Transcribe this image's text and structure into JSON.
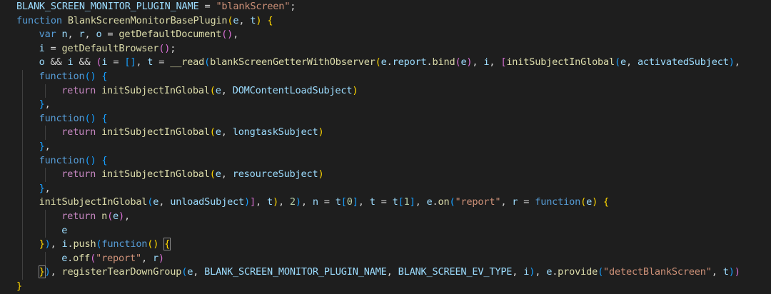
{
  "colors": {
    "background": "#1e1e1e",
    "var": "#9cdcfe",
    "keyword": "#569cd6",
    "control": "#c586c0",
    "function": "#dcdcaa",
    "string": "#ce9178",
    "number": "#b5cea8",
    "punct": "#d4d4d4",
    "bracket_gold": "#ffd700",
    "bracket_violet": "#da70d6",
    "bracket_blue": "#179fff",
    "indent_guide": "#404040"
  },
  "lines": [
    {
      "indent": 0,
      "guides": 0,
      "tokens": [
        [
          "BLANK_SCREEN_MONITOR_PLUGIN_NAME",
          "var"
        ],
        [
          " = ",
          "punct"
        ],
        [
          "\"blankScreen\"",
          "string"
        ],
        [
          ";",
          "punct"
        ]
      ]
    },
    {
      "indent": 0,
      "guides": 0,
      "tokens": [
        [
          "function",
          "keyword"
        ],
        [
          " ",
          "punct"
        ],
        [
          "BlankScreenMonitorBasePlugin",
          "function"
        ],
        [
          "(",
          "bracket_gold"
        ],
        [
          "e",
          "var"
        ],
        [
          ", ",
          "punct"
        ],
        [
          "t",
          "var"
        ],
        [
          ")",
          "bracket_gold"
        ],
        [
          " ",
          "punct"
        ],
        [
          "{",
          "bracket_gold"
        ]
      ]
    },
    {
      "indent": 1,
      "guides": 0,
      "tokens": [
        [
          "var",
          "keyword"
        ],
        [
          " ",
          "punct"
        ],
        [
          "n",
          "var"
        ],
        [
          ", ",
          "punct"
        ],
        [
          "r",
          "var"
        ],
        [
          ", ",
          "punct"
        ],
        [
          "o",
          "var"
        ],
        [
          " = ",
          "punct"
        ],
        [
          "getDefaultDocument",
          "function"
        ],
        [
          "()",
          "bracket_violet"
        ],
        [
          ",",
          "punct"
        ]
      ]
    },
    {
      "indent": 1,
      "guides": 0,
      "tokens": [
        [
          "i",
          "var"
        ],
        [
          " = ",
          "punct"
        ],
        [
          "getDefaultBrowser",
          "function"
        ],
        [
          "()",
          "bracket_violet"
        ],
        [
          ";",
          "punct"
        ]
      ]
    },
    {
      "indent": 1,
      "guides": 0,
      "tokens": [
        [
          "o",
          "var"
        ],
        [
          " && ",
          "punct"
        ],
        [
          "i",
          "var"
        ],
        [
          " && ",
          "punct"
        ],
        [
          "(",
          "bracket_violet"
        ],
        [
          "i",
          "var"
        ],
        [
          " = ",
          "punct"
        ],
        [
          "[]",
          "bracket_blue"
        ],
        [
          ", ",
          "punct"
        ],
        [
          "t",
          "var"
        ],
        [
          " = ",
          "punct"
        ],
        [
          "__read",
          "function"
        ],
        [
          "(",
          "bracket_blue"
        ],
        [
          "blankScreenGetterWithObserver",
          "function"
        ],
        [
          "(",
          "bracket_gold"
        ],
        [
          "e",
          "var"
        ],
        [
          ".",
          "punct"
        ],
        [
          "report",
          "var"
        ],
        [
          ".",
          "punct"
        ],
        [
          "bind",
          "function"
        ],
        [
          "(",
          "bracket_violet"
        ],
        [
          "e",
          "var"
        ],
        [
          ")",
          "bracket_violet"
        ],
        [
          ", ",
          "punct"
        ],
        [
          "i",
          "var"
        ],
        [
          ", ",
          "punct"
        ],
        [
          "[",
          "bracket_violet"
        ],
        [
          "initSubjectInGlobal",
          "function"
        ],
        [
          "(",
          "bracket_blue"
        ],
        [
          "e",
          "var"
        ],
        [
          ", ",
          "punct"
        ],
        [
          "activatedSubject",
          "var"
        ],
        [
          ")",
          "bracket_blue"
        ],
        [
          ",",
          "punct"
        ]
      ]
    },
    {
      "indent": 1,
      "guides": 1,
      "tokens": [
        [
          "function",
          "keyword"
        ],
        [
          "()",
          "bracket_blue"
        ],
        [
          " ",
          "punct"
        ],
        [
          "{",
          "bracket_blue"
        ]
      ]
    },
    {
      "indent": 2,
      "guides": 2,
      "tokens": [
        [
          "return",
          "control"
        ],
        [
          " ",
          "punct"
        ],
        [
          "initSubjectInGlobal",
          "function"
        ],
        [
          "(",
          "bracket_gold"
        ],
        [
          "e",
          "var"
        ],
        [
          ", ",
          "punct"
        ],
        [
          "DOMContentLoadSubject",
          "var"
        ],
        [
          ")",
          "bracket_gold"
        ]
      ]
    },
    {
      "indent": 1,
      "guides": 1,
      "tokens": [
        [
          "}",
          "bracket_blue"
        ],
        [
          ",",
          "punct"
        ]
      ]
    },
    {
      "indent": 1,
      "guides": 1,
      "tokens": [
        [
          "function",
          "keyword"
        ],
        [
          "()",
          "bracket_blue"
        ],
        [
          " ",
          "punct"
        ],
        [
          "{",
          "bracket_blue"
        ]
      ]
    },
    {
      "indent": 2,
      "guides": 2,
      "tokens": [
        [
          "return",
          "control"
        ],
        [
          " ",
          "punct"
        ],
        [
          "initSubjectInGlobal",
          "function"
        ],
        [
          "(",
          "bracket_gold"
        ],
        [
          "e",
          "var"
        ],
        [
          ", ",
          "punct"
        ],
        [
          "longtaskSubject",
          "var"
        ],
        [
          ")",
          "bracket_gold"
        ]
      ]
    },
    {
      "indent": 1,
      "guides": 1,
      "tokens": [
        [
          "}",
          "bracket_blue"
        ],
        [
          ",",
          "punct"
        ]
      ]
    },
    {
      "indent": 1,
      "guides": 1,
      "tokens": [
        [
          "function",
          "keyword"
        ],
        [
          "()",
          "bracket_blue"
        ],
        [
          " ",
          "punct"
        ],
        [
          "{",
          "bracket_blue"
        ]
      ]
    },
    {
      "indent": 2,
      "guides": 2,
      "tokens": [
        [
          "return",
          "control"
        ],
        [
          " ",
          "punct"
        ],
        [
          "initSubjectInGlobal",
          "function"
        ],
        [
          "(",
          "bracket_gold"
        ],
        [
          "e",
          "var"
        ],
        [
          ", ",
          "punct"
        ],
        [
          "resourceSubject",
          "var"
        ],
        [
          ")",
          "bracket_gold"
        ]
      ]
    },
    {
      "indent": 1,
      "guides": 1,
      "tokens": [
        [
          "}",
          "bracket_blue"
        ],
        [
          ",",
          "punct"
        ]
      ]
    },
    {
      "indent": 1,
      "guides": 1,
      "tokens": [
        [
          "initSubjectInGlobal",
          "function"
        ],
        [
          "(",
          "bracket_blue"
        ],
        [
          "e",
          "var"
        ],
        [
          ", ",
          "punct"
        ],
        [
          "unloadSubject",
          "var"
        ],
        [
          ")",
          "bracket_blue"
        ],
        [
          "]",
          "bracket_violet"
        ],
        [
          ", ",
          "punct"
        ],
        [
          "t",
          "var"
        ],
        [
          ")",
          "bracket_gold"
        ],
        [
          ", ",
          "punct"
        ],
        [
          "2",
          "number"
        ],
        [
          ")",
          "bracket_blue"
        ],
        [
          ", ",
          "punct"
        ],
        [
          "n",
          "var"
        ],
        [
          " = ",
          "punct"
        ],
        [
          "t",
          "var"
        ],
        [
          "[",
          "bracket_blue"
        ],
        [
          "0",
          "number"
        ],
        [
          "]",
          "bracket_blue"
        ],
        [
          ", ",
          "punct"
        ],
        [
          "t",
          "var"
        ],
        [
          " = ",
          "punct"
        ],
        [
          "t",
          "var"
        ],
        [
          "[",
          "bracket_blue"
        ],
        [
          "1",
          "number"
        ],
        [
          "]",
          "bracket_blue"
        ],
        [
          ", ",
          "punct"
        ],
        [
          "e",
          "var"
        ],
        [
          ".",
          "punct"
        ],
        [
          "on",
          "function"
        ],
        [
          "(",
          "bracket_blue"
        ],
        [
          "\"report\"",
          "string"
        ],
        [
          ", ",
          "punct"
        ],
        [
          "r",
          "var"
        ],
        [
          " = ",
          "punct"
        ],
        [
          "function",
          "keyword"
        ],
        [
          "(",
          "bracket_gold"
        ],
        [
          "e",
          "var"
        ],
        [
          ")",
          "bracket_gold"
        ],
        [
          " ",
          "punct"
        ],
        [
          "{",
          "bracket_gold"
        ]
      ]
    },
    {
      "indent": 2,
      "guides": 2,
      "tokens": [
        [
          "return",
          "control"
        ],
        [
          " ",
          "punct"
        ],
        [
          "n",
          "function"
        ],
        [
          "(",
          "bracket_violet"
        ],
        [
          "e",
          "var"
        ],
        [
          ")",
          "bracket_violet"
        ],
        [
          ",",
          "punct"
        ]
      ]
    },
    {
      "indent": 2,
      "guides": 2,
      "tokens": [
        [
          "e",
          "var"
        ]
      ]
    },
    {
      "indent": 1,
      "guides": 1,
      "tokens": [
        [
          "}",
          "bracket_gold"
        ],
        [
          ")",
          "bracket_blue"
        ],
        [
          ", ",
          "punct"
        ],
        [
          "i",
          "var"
        ],
        [
          ".",
          "punct"
        ],
        [
          "push",
          "function"
        ],
        [
          "(",
          "bracket_blue"
        ],
        [
          "function",
          "keyword"
        ],
        [
          "()",
          "bracket_gold"
        ],
        [
          " ",
          "punct"
        ],
        [
          "{",
          "bracket_gold",
          "box"
        ]
      ]
    },
    {
      "indent": 2,
      "guides": 2,
      "tokens": [
        [
          "e",
          "var"
        ],
        [
          ".",
          "punct"
        ],
        [
          "off",
          "function"
        ],
        [
          "(",
          "bracket_violet"
        ],
        [
          "\"report\"",
          "string"
        ],
        [
          ", ",
          "punct"
        ],
        [
          "r",
          "var"
        ],
        [
          ")",
          "bracket_violet"
        ]
      ]
    },
    {
      "indent": 1,
      "guides": 1,
      "tokens": [
        [
          "}",
          "bracket_gold",
          "box"
        ],
        [
          ")",
          "bracket_blue"
        ],
        [
          ", ",
          "punct"
        ],
        [
          "registerTearDownGroup",
          "function"
        ],
        [
          "(",
          "bracket_blue"
        ],
        [
          "e",
          "var"
        ],
        [
          ", ",
          "punct"
        ],
        [
          "BLANK_SCREEN_MONITOR_PLUGIN_NAME",
          "var"
        ],
        [
          ", ",
          "punct"
        ],
        [
          "BLANK_SCREEN_EV_TYPE",
          "var"
        ],
        [
          ", ",
          "punct"
        ],
        [
          "i",
          "var"
        ],
        [
          ")",
          "bracket_blue"
        ],
        [
          ", ",
          "punct"
        ],
        [
          "e",
          "var"
        ],
        [
          ".",
          "punct"
        ],
        [
          "provide",
          "function"
        ],
        [
          "(",
          "bracket_blue"
        ],
        [
          "\"detectBlankScreen\"",
          "string"
        ],
        [
          ", ",
          "punct"
        ],
        [
          "t",
          "var"
        ],
        [
          ")",
          "bracket_blue"
        ],
        [
          ")",
          "bracket_violet"
        ]
      ]
    },
    {
      "indent": 0,
      "guides": 0,
      "tokens": [
        [
          "}",
          "bracket_gold"
        ]
      ]
    }
  ]
}
